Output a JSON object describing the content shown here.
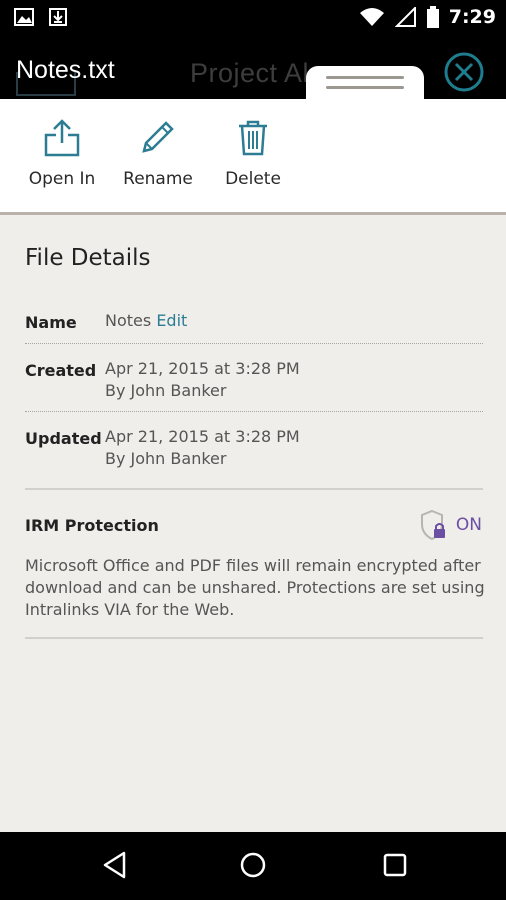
{
  "status_bar": {
    "time": "7:29",
    "icons": [
      "image-icon",
      "download-icon",
      "wifi-icon",
      "signal-icon",
      "battery-icon"
    ]
  },
  "header": {
    "file_title": "Notes.txt",
    "background_title": "Project Al",
    "close_icon": "close-circle-icon",
    "accent_color": "#1e7d8f"
  },
  "actions": [
    {
      "label": "Open In",
      "icon": "share-upload-icon"
    },
    {
      "label": "Rename",
      "icon": "pencil-icon"
    },
    {
      "label": "Delete",
      "icon": "trash-icon"
    }
  ],
  "details": {
    "title": "File Details",
    "name_label": "Name",
    "name_value": "Notes",
    "name_edit": "Edit",
    "created_label": "Created",
    "created_date": "Apr 21, 2015 at 3:28 PM",
    "created_by": "By John Banker",
    "updated_label": "Updated",
    "updated_date": "Apr 21, 2015 at 3:28 PM",
    "updated_by": "By John Banker",
    "irm_label": "IRM Protection",
    "irm_state": "ON",
    "irm_icon": "shield-lock-icon",
    "irm_color": "#6a4fa3",
    "irm_description": "Microsoft Office and PDF files will remain encrypted after download and can be unshared. Protections are set using Intralinks VIA for the Web."
  },
  "nav": {
    "icons": [
      "back-icon",
      "home-icon",
      "recents-icon"
    ]
  }
}
